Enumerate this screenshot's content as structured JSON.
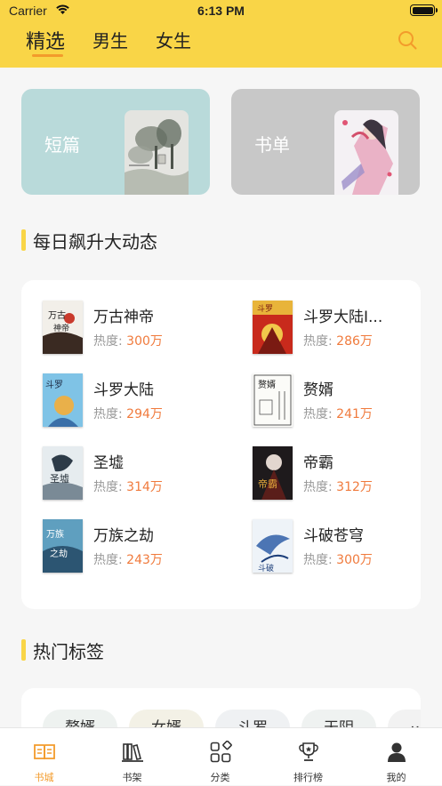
{
  "status_bar": {
    "carrier": "Carrier",
    "time": "6:13 PM"
  },
  "top_tabs": [
    {
      "label": "精选",
      "active": true
    },
    {
      "label": "男生",
      "active": false
    },
    {
      "label": "女生",
      "active": false
    }
  ],
  "accent_color": "#f9d547",
  "highlight_color": "#f39b2b",
  "cards": [
    {
      "label": "短篇",
      "icon": "landscape-painting-cover"
    },
    {
      "label": "书单",
      "icon": "illustrated-girl-cover"
    }
  ],
  "sections": {
    "rising": "每日飙升大动态",
    "tags": "热门标签"
  },
  "heat_label": "热度:",
  "books": [
    {
      "title": "万古神帝",
      "heat": "300万"
    },
    {
      "title": "斗罗大陆I...",
      "heat": "286万"
    },
    {
      "title": "斗罗大陆",
      "heat": "294万"
    },
    {
      "title": "赘婿",
      "heat": "241万"
    },
    {
      "title": "圣墟",
      "heat": "314万"
    },
    {
      "title": "帝霸",
      "heat": "312万"
    },
    {
      "title": "万族之劫",
      "heat": "243万"
    },
    {
      "title": "斗破苍穹",
      "heat": "300万"
    }
  ],
  "tags": [
    "赘婿",
    "女婿",
    "斗罗",
    "天阴",
    "……"
  ],
  "bottom_tabs": [
    {
      "label": "书城",
      "icon": "book-open-icon",
      "active": true
    },
    {
      "label": "书架",
      "icon": "bookshelf-icon",
      "active": false
    },
    {
      "label": "分类",
      "icon": "category-grid-icon",
      "active": false
    },
    {
      "label": "排行榜",
      "icon": "trophy-icon",
      "active": false
    },
    {
      "label": "我的",
      "icon": "user-icon",
      "active": false
    }
  ]
}
